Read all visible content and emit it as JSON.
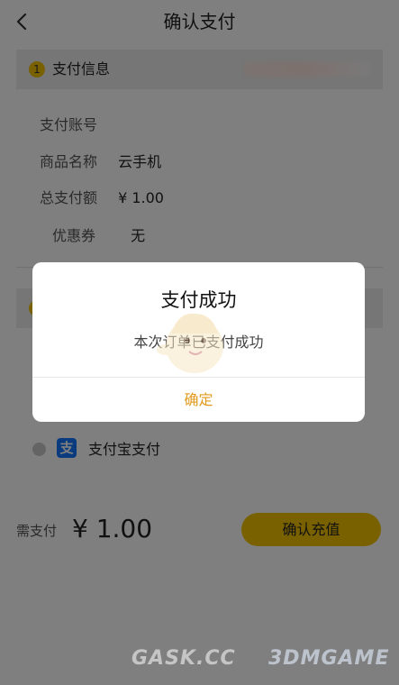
{
  "header": {
    "title": "确认支付",
    "back_icon": "chevron-left-icon"
  },
  "section1": {
    "index": "1",
    "label": "支付信息"
  },
  "info_rows": [
    {
      "label": "支付账号",
      "value": ""
    },
    {
      "label": "商品名称",
      "value": "云手机"
    },
    {
      "label": "总支付额",
      "value": "¥ 1.00"
    },
    {
      "label": "优惠券",
      "value": "无"
    }
  ],
  "payment_method": {
    "label": "支付宝支付",
    "icon": "alipay-icon",
    "logo_text": "支"
  },
  "footer": {
    "pay_label": "需支付",
    "amount": "¥ 1.00",
    "confirm_label": "确认充值"
  },
  "dialog": {
    "title": "支付成功",
    "message": "本次订单已支付成功",
    "ok_label": "确定"
  },
  "watermark": {
    "left": "GASK.CC",
    "right": "3DMGAME"
  },
  "colors": {
    "accent": "#f2c300",
    "ok_text": "#e09a1a",
    "alipay": "#1677ff"
  }
}
